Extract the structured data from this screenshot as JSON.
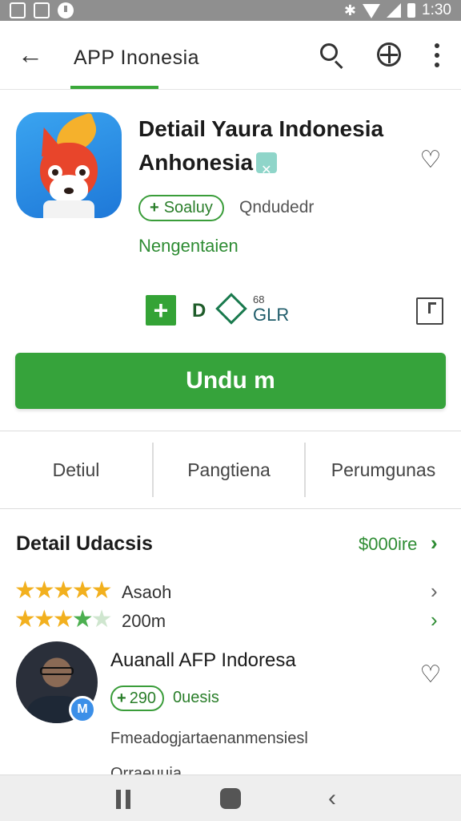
{
  "status_bar": {
    "time": "1:30"
  },
  "app_bar": {
    "title": "APP Inonesia"
  },
  "app": {
    "name_line1": "Detiail Yaura Indonesia",
    "name_line2": "Anhonesia",
    "chip_label": "Soaluy",
    "chip_secondary": "Qndudedr",
    "developer": "Nengentaien",
    "d_label": "D",
    "mini_top": "68",
    "mini_bottom": "GLR",
    "install_label": "Undu m"
  },
  "tabs": [
    {
      "label": "Detiul"
    },
    {
      "label": "Pangtiena"
    },
    {
      "label": "Perumgunas"
    }
  ],
  "details": {
    "title": "Detail Udacsis",
    "link": "$000ire",
    "rating_rows": [
      {
        "label": "Asaoh",
        "stars": 5
      },
      {
        "label": "200m",
        "stars": 4
      }
    ]
  },
  "review": {
    "name": "Auanall AFP Indoresa",
    "chip_value": "290",
    "chip_extra": "0uesis",
    "text": "Fmeadogjartaenanmensiesl",
    "cutoff": "Orraeuuia"
  },
  "colors": {
    "accent_green": "#36a33b",
    "star_yellow": "#f2b01e",
    "status_bar": "#8f8f8f"
  },
  "icons": {
    "back": "arrow-left-icon",
    "search": "search-icon",
    "share": "globe-icon",
    "more": "more-vertical-icon",
    "wishlist": "heart-outline-icon",
    "bookmark": "bookmark-icon"
  }
}
